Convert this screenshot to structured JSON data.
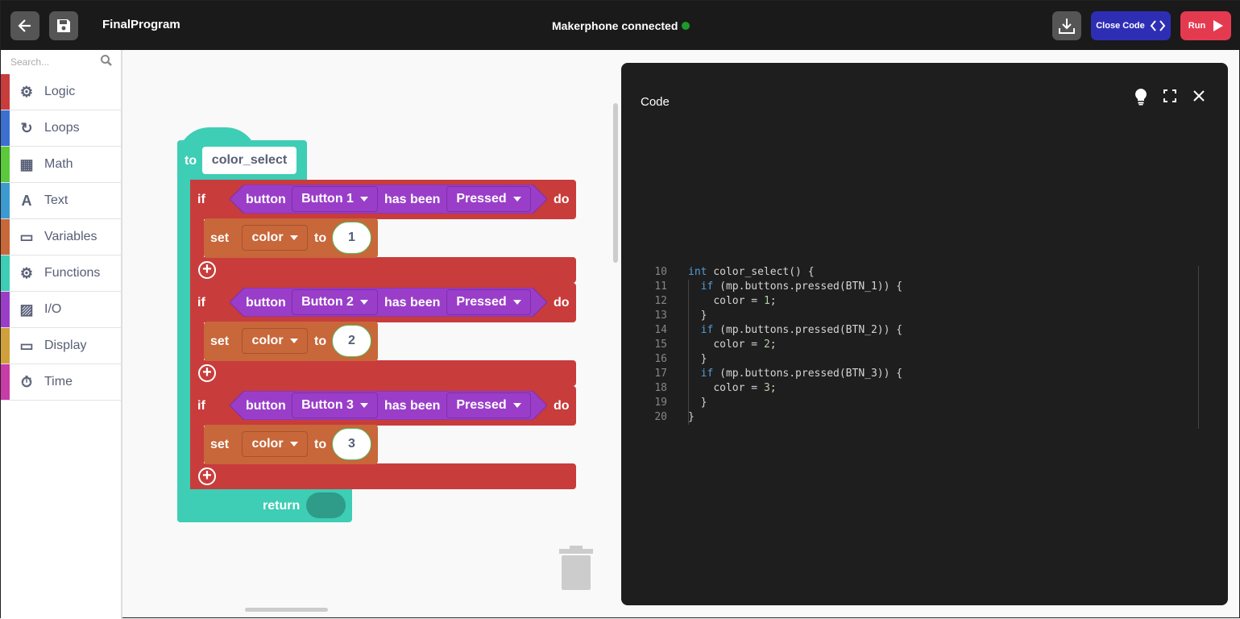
{
  "header": {
    "title": "FinalProgram",
    "status": "Makerphone connected",
    "status_color": "#1d9a2a",
    "close_code_label": "Close Code",
    "run_label": "Run",
    "back_icon": "arrow-left-icon",
    "save_icon": "floppy-icon",
    "download_icon": "download-icon"
  },
  "sidebar": {
    "search_placeholder": "Search...",
    "categories": [
      {
        "label": "Logic",
        "color": "#c83c3c",
        "icon": "⚙"
      },
      {
        "label": "Loops",
        "color": "#3c6fd0",
        "icon": "↻"
      },
      {
        "label": "Math",
        "color": "#5ac93c",
        "icon": "▦"
      },
      {
        "label": "Text",
        "color": "#3c9ad0",
        "icon": "A"
      },
      {
        "label": "Variables",
        "color": "#c8673a",
        "icon": "▭"
      },
      {
        "label": "Functions",
        "color": "#3ecdb5",
        "icon": "⚙"
      },
      {
        "label": "I/O",
        "color": "#9a3ec9",
        "icon": "▨"
      },
      {
        "label": "Display",
        "color": "#d0a03c",
        "icon": "▭"
      },
      {
        "label": "Time",
        "color": "#c83ca8",
        "icon": "⏱"
      }
    ]
  },
  "workspace": {
    "function": {
      "to_label": "to",
      "name": "color_select",
      "return_label": "return"
    },
    "ifs": [
      {
        "if": "if",
        "button": "button",
        "which": "Button 1",
        "has_been": "has been",
        "state": "Pressed",
        "do": "do",
        "set": "set",
        "var": "color",
        "to": "to",
        "value": "1"
      },
      {
        "if": "if",
        "button": "button",
        "which": "Button 2",
        "has_been": "has been",
        "state": "Pressed",
        "do": "do",
        "set": "set",
        "var": "color",
        "to": "to",
        "value": "2"
      },
      {
        "if": "if",
        "button": "button",
        "which": "Button 3",
        "has_been": "has been",
        "state": "Pressed",
        "do": "do",
        "set": "set",
        "var": "color",
        "to": "to",
        "value": "3"
      }
    ]
  },
  "code": {
    "title": "Code",
    "lines": [
      {
        "n": "10",
        "indent": "",
        "kw": "int",
        "rest": " color_select() {",
        "num": "",
        "end": ""
      },
      {
        "n": "11",
        "indent": "  ",
        "kw": "if",
        "rest": " (mp.buttons.pressed(BTN_1)) {",
        "num": "",
        "end": ""
      },
      {
        "n": "12",
        "indent": "    ",
        "kw": "",
        "rest": "color = ",
        "num": "1",
        "end": ";"
      },
      {
        "n": "13",
        "indent": "  ",
        "kw": "",
        "rest": "}",
        "num": "",
        "end": ""
      },
      {
        "n": "14",
        "indent": "  ",
        "kw": "if",
        "rest": " (mp.buttons.pressed(BTN_2)) {",
        "num": "",
        "end": ""
      },
      {
        "n": "15",
        "indent": "    ",
        "kw": "",
        "rest": "color = ",
        "num": "2",
        "end": ";"
      },
      {
        "n": "16",
        "indent": "  ",
        "kw": "",
        "rest": "}",
        "num": "",
        "end": ""
      },
      {
        "n": "17",
        "indent": "  ",
        "kw": "if",
        "rest": " (mp.buttons.pressed(BTN_3)) {",
        "num": "",
        "end": ""
      },
      {
        "n": "18",
        "indent": "    ",
        "kw": "",
        "rest": "color = ",
        "num": "3",
        "end": ";"
      },
      {
        "n": "19",
        "indent": "  ",
        "kw": "",
        "rest": "}",
        "num": "",
        "end": ""
      },
      {
        "n": "20",
        "indent": "",
        "kw": "",
        "rest": "}",
        "num": "",
        "end": ""
      }
    ]
  }
}
